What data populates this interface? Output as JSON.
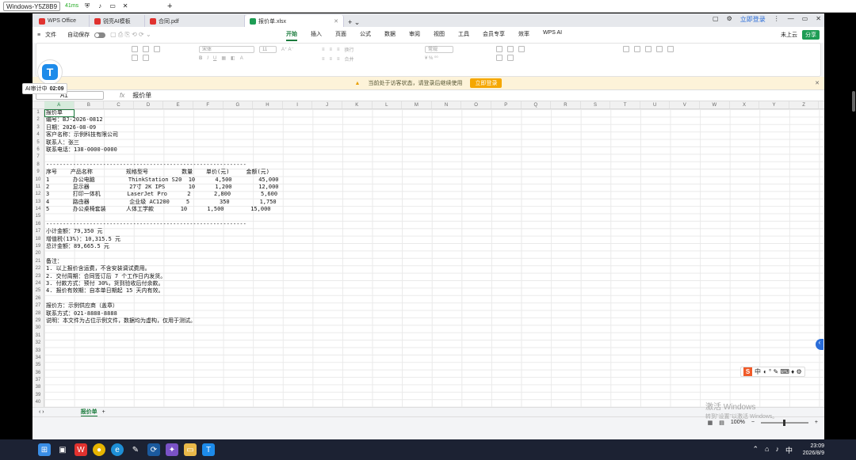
{
  "remote": {
    "title": "Windows-Y5Z8B9",
    "latency": "41ms"
  },
  "tabs": [
    {
      "label": "WPS Office",
      "color": "#e0322f"
    },
    {
      "label": "锐亮AI模板",
      "color": "#e0322f"
    },
    {
      "label": "合同.pdf",
      "color": "#e0322f"
    },
    {
      "label": "报价单.xlsx",
      "color": "#1e9d55",
      "active": true
    }
  ],
  "menu": {
    "file": "文件",
    "autosave": "自动保存",
    "tabs": [
      "开始",
      "插入",
      "页面",
      "公式",
      "数据",
      "审阅",
      "视图",
      "工具",
      "会员专享",
      "效率",
      "WPS AI"
    ],
    "active_tab": "开始",
    "login": "立即登录",
    "cloud": "未上云",
    "share": "分享"
  },
  "ribbon": {
    "font": "宋体",
    "size": "11",
    "format": "常规",
    "wrap": "换行",
    "merge": "合并"
  },
  "notice": {
    "text": "当前处于访客状态，请登录后继续使用",
    "button": "立即登录"
  },
  "ai_badge": {
    "label": "AI审计中",
    "time": "02:09"
  },
  "formula": {
    "name": "A1",
    "fx": "fx",
    "value": "报价单"
  },
  "columns": [
    "A",
    "B",
    "C",
    "D",
    "E",
    "F",
    "G",
    "H",
    "I",
    "J",
    "K",
    "L",
    "M",
    "N",
    "O",
    "P",
    "Q",
    "R",
    "S",
    "T",
    "U",
    "V",
    "W",
    "X",
    "Y",
    "Z"
  ],
  "rows": [
    "1",
    "2",
    "3",
    "4",
    "5",
    "6",
    "7",
    "8",
    "9",
    "10",
    "11",
    "12",
    "13",
    "14",
    "15",
    "16",
    "17",
    "18",
    "19",
    "20",
    "21",
    "22",
    "23",
    "24",
    "25",
    "26",
    "27",
    "28",
    "29",
    "30",
    "31",
    "32",
    "33",
    "34",
    "35",
    "36",
    "37",
    "38",
    "39",
    "40"
  ],
  "lines": [
    "报价单",
    "编号：BJ-2026-0812",
    "日期：2026-08-09",
    "客户名称：示例科技有限公司",
    "联系人：张三",
    "联系电话：138-0000-0000",
    "",
    "------------------------------------------------------------",
    "序号    产品名称          规格型号          数量    单价(元)     金额(元)",
    "1       办公电脑          ThinkStation S20  10      4,500        45,000",
    "2       显示器            27寸 2K IPS       10      1,200        12,000",
    "3       打印一体机        LaserJet Pro      2       2,800         5,600",
    "4       路由器            企业级 AC1200     5         350         1,750",
    "5       办公桌椅套装      人体工学款        10      1,500        15,000",
    "",
    "------------------------------------------------------------",
    "小计金额：79,350 元",
    "增值税(13%)：10,315.5 元",
    "总计金额：89,665.5 元",
    "",
    "备注：",
    "1. 以上报价含运费，不含安装调试费用。",
    "2. 交付周期：合同签订后 7 个工作日内发货。",
    "3. 付款方式：预付 30%，货到验收后付余款。",
    "4. 报价有效期：自本单日期起 15 天内有效。",
    "",
    "报价方：示例供应商（盖章）",
    "联系方式：021-8888-8888",
    "说明：本文件为占位示例文件，数据均为虚构，仅用于测试。"
  ],
  "sheet": {
    "name": "报价单"
  },
  "status": {
    "zoom": "100%"
  },
  "watermark": {
    "title": "激活 Windows",
    "sub": "转到\"设置\"以激活 Windows。"
  },
  "clock": {
    "time": "23:09",
    "date": "2026/8/9"
  }
}
